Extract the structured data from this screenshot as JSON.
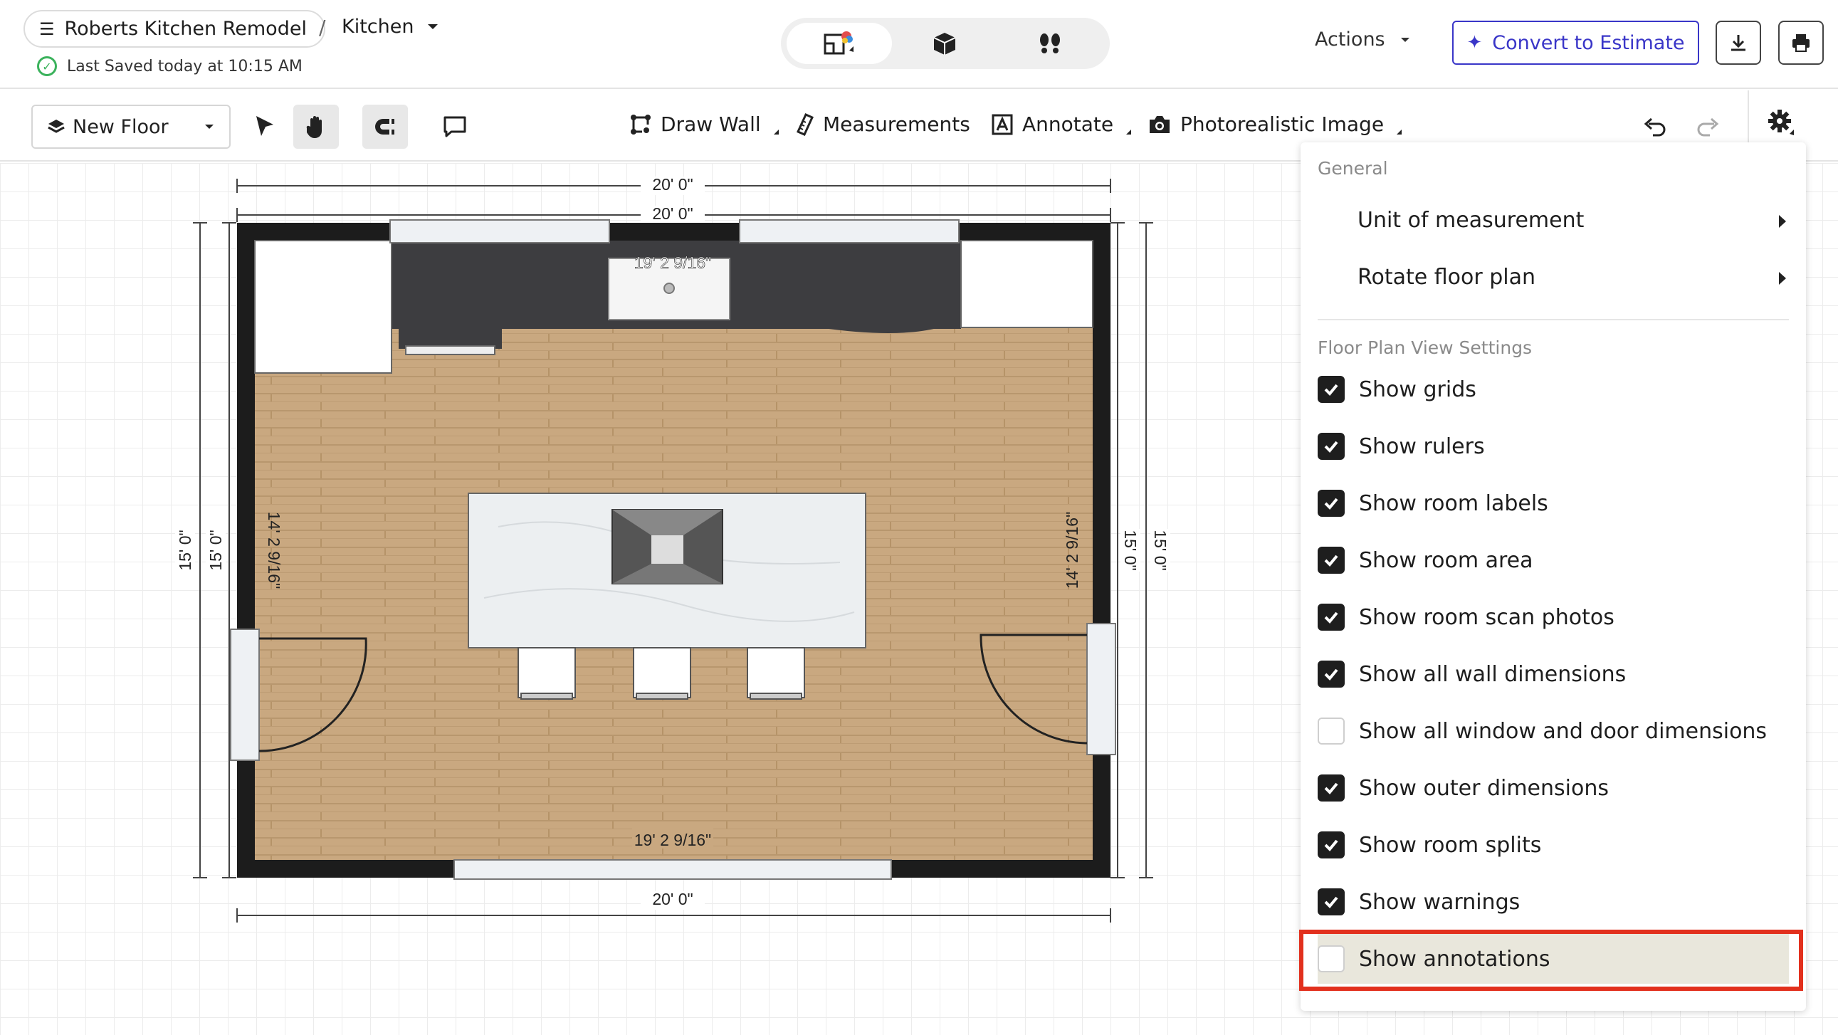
{
  "header": {
    "project_name": "Roberts Kitchen Remodel",
    "breadcrumb_separator": "/",
    "room_name": "Kitchen",
    "saved_status": "Last Saved today at 10:15 AM",
    "actions_label": "Actions",
    "convert_label": "Convert to Estimate"
  },
  "toolbar": {
    "floor_label": "New Floor",
    "draw_wall_label": "Draw Wall",
    "measurements_label": "Measurements",
    "annotate_label": "Annotate",
    "photo_label": "Photorealistic Image"
  },
  "floor_plan": {
    "outer_top_dim": "20' 0\"",
    "inner_top_dim": "20' 0\"",
    "bottom_dim": "20' 0\"",
    "left_outer_dim": "15' 0\"",
    "left_inner_dim": "15' 0\"",
    "right_inner_dim": "15' 0\"",
    "right_outer_dim": "15' 0\"",
    "top_wall_label": "19' 2 9/16\"",
    "bottom_wall_label": "19' 2 9/16\"",
    "left_wall_label": "14' 2 9/16\"",
    "right_wall_label": "14' 2 9/16\"",
    "floor_color": "#c9a880",
    "wall_color": "#1c1c1c",
    "counter_color": "#3d3d40"
  },
  "settings_menu": {
    "general_heading": "General",
    "unit_label": "Unit of measurement",
    "rotate_label": "Rotate floor plan",
    "view_heading": "Floor Plan View Settings",
    "options": [
      {
        "label": "Show grids",
        "checked": true
      },
      {
        "label": "Show rulers",
        "checked": true
      },
      {
        "label": "Show room labels",
        "checked": true
      },
      {
        "label": "Show room area",
        "checked": true
      },
      {
        "label": "Show room scan photos",
        "checked": true
      },
      {
        "label": "Show all wall dimensions",
        "checked": true
      },
      {
        "label": "Show all window and door dimensions",
        "checked": false
      },
      {
        "label": "Show outer dimensions",
        "checked": true
      },
      {
        "label": "Show room splits",
        "checked": true
      },
      {
        "label": "Show warnings",
        "checked": true
      },
      {
        "label": "Show annotations",
        "checked": false
      }
    ],
    "highlight_color": "#e2301d"
  }
}
